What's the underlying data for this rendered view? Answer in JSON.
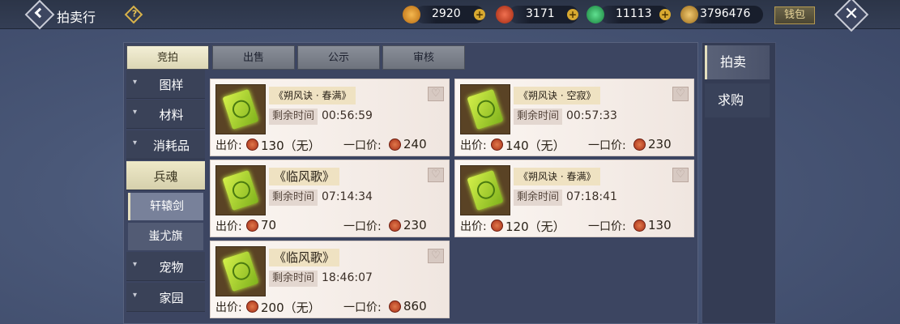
{
  "header": {
    "title": "拍卖行",
    "help_label": "?",
    "wallet_label": "钱包",
    "close_label": "✕",
    "currencies": [
      {
        "icon": "gold-ingot-icon",
        "value": "2920",
        "color": "#e08a2a"
      },
      {
        "icon": "red-coin-icon",
        "value": "3171",
        "color": "#c8402a"
      },
      {
        "icon": "jade-icon",
        "value": "11113",
        "color": "#2aa860"
      },
      {
        "icon": "silver-ingot-icon",
        "value": "3796476",
        "color": "#c89a3a"
      }
    ]
  },
  "tabs": [
    {
      "label": "竞拍",
      "active": true
    },
    {
      "label": "出售",
      "active": false
    },
    {
      "label": "公示",
      "active": false
    },
    {
      "label": "审核",
      "active": false
    }
  ],
  "categories": [
    {
      "label": "图样",
      "type": "cat"
    },
    {
      "label": "材料",
      "type": "cat"
    },
    {
      "label": "消耗品",
      "type": "cat"
    },
    {
      "label": "兵魂",
      "type": "cat-active"
    },
    {
      "label": "轩辕剑",
      "type": "sub-active"
    },
    {
      "label": "蚩尤旗",
      "type": "sub"
    },
    {
      "label": "宠物",
      "type": "cat"
    },
    {
      "label": "家园",
      "type": "cat"
    }
  ],
  "labels": {
    "time_label": "剩余时间",
    "price_label": "出价:",
    "buyout_label": "一口价:"
  },
  "listings": [
    {
      "name": "《朔风诀 · 春满》",
      "time": "00:56:59",
      "bid": "130（无）",
      "buyout": "240"
    },
    {
      "name": "《朔风诀 · 空寂》",
      "time": "00:57:33",
      "bid": "140（无）",
      "buyout": "230"
    },
    {
      "name": "《临风歌》",
      "time": "07:14:34",
      "bid": "70",
      "buyout": "230"
    },
    {
      "name": "《朔风诀 · 春满》",
      "time": "07:18:41",
      "bid": "120（无）",
      "buyout": "130"
    },
    {
      "name": "《临风歌》",
      "time": "18:46:07",
      "bid": "200（无）",
      "buyout": "860"
    }
  ],
  "right_tabs": [
    {
      "label": "拍卖",
      "active": true
    },
    {
      "label": "求购",
      "active": false
    }
  ]
}
